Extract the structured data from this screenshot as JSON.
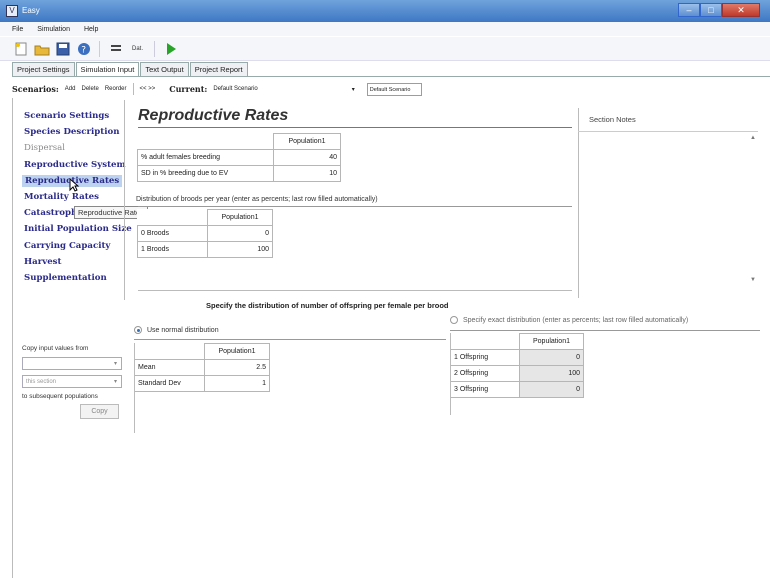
{
  "window": {
    "title": "Easy"
  },
  "menu": {
    "items": [
      "File",
      "Simulation",
      "Help"
    ]
  },
  "toolbar": {
    "label": "Dat."
  },
  "tabs": [
    "Project Settings",
    "Simulation Input",
    "Text Output",
    "Project Report"
  ],
  "scenarios": {
    "label": "Scenarios:",
    "actions": [
      "Add",
      "Delete",
      "Reorder"
    ],
    "nav": "<<  >>",
    "current_label": "Current:",
    "current_value": "Default Scenario",
    "select_value": "Default Scenario"
  },
  "nav": {
    "items": [
      "Scenario Settings",
      "Species Description",
      "Dispersal",
      "Reproductive System",
      "Reproductive Rates",
      "Mortality Rates",
      "Catastrophes",
      "Initial Population Size",
      "Carrying Capacity",
      "Harvest",
      "Supplementation"
    ],
    "tooltip": "Reproductive Rates"
  },
  "copy": {
    "label": "Copy input values from",
    "select1": "",
    "select2": "this section",
    "label2": "to subsequent populations",
    "button": "Copy"
  },
  "page": {
    "title": "Reproductive Rates",
    "notes_label": "Section Notes"
  },
  "breeding_grid": {
    "header": "Population1",
    "rows": [
      {
        "label": "% adult females breeding",
        "value": "40"
      },
      {
        "label": "SD in % breeding due to EV",
        "value": "10"
      }
    ]
  },
  "broods": {
    "caption": "Distribution of broods per year (enter as percents; last row filled automatically)",
    "header": "Population1",
    "rows": [
      {
        "label": "0 Broods",
        "value": "0"
      },
      {
        "label": "1 Broods",
        "value": "100"
      }
    ]
  },
  "offspring": {
    "title": "Specify the distribution of number of offspring per female per brood",
    "normal_label": "Use normal distribution",
    "exact_label": "Specify exact distribution (enter as percents; last row filled automatically)",
    "normal": {
      "header": "Population1",
      "rows": [
        {
          "label": "Mean",
          "value": "2.5"
        },
        {
          "label": "Standard Dev",
          "value": "1"
        }
      ]
    },
    "exact": {
      "header": "Population1",
      "rows": [
        {
          "label": "1 Offspring",
          "value": "0"
        },
        {
          "label": "2 Offspring",
          "value": "100"
        },
        {
          "label": "3 Offspring",
          "value": "0"
        }
      ]
    }
  }
}
